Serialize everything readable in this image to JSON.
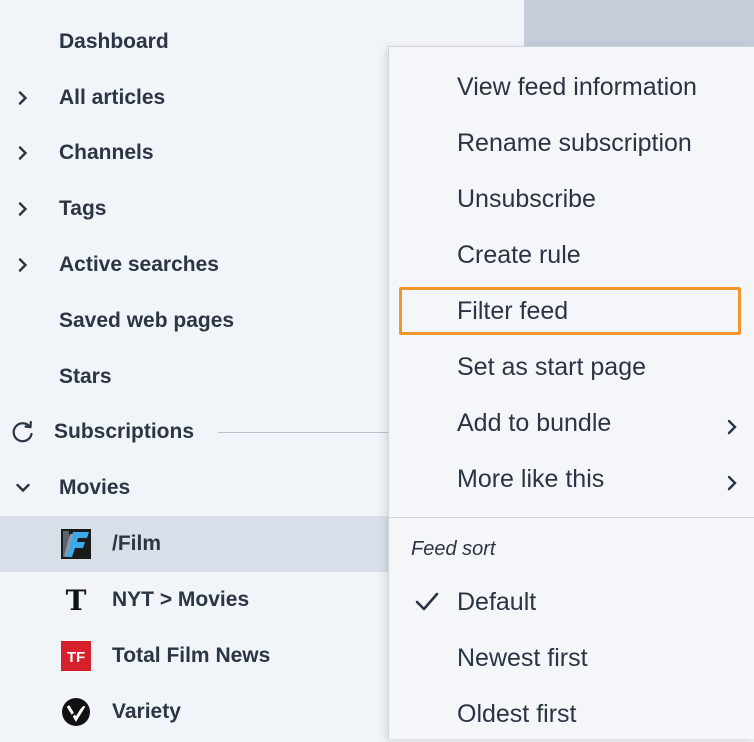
{
  "sidebar": {
    "items": [
      {
        "label": "Dashboard",
        "chevron": "none"
      },
      {
        "label": "All articles",
        "chevron": "chevron-right"
      },
      {
        "label": "Channels",
        "chevron": "chevron-right"
      },
      {
        "label": "Tags",
        "chevron": "chevron-right"
      },
      {
        "label": "Active searches",
        "chevron": "chevron-right"
      },
      {
        "label": "Saved web pages",
        "chevron": "none"
      },
      {
        "label": "Stars",
        "chevron": "none"
      }
    ],
    "subscriptions": {
      "label": "Subscriptions",
      "icon": "refresh-icon"
    },
    "folder": {
      "label": "Movies",
      "chevron": "chevron-down"
    },
    "feeds": [
      {
        "label": "/Film",
        "icon": "slashfilm-icon",
        "selected": true
      },
      {
        "label": "NYT > Movies",
        "icon": "nyt-icon",
        "selected": false
      },
      {
        "label": "Total Film News",
        "icon": "totalfilm-icon",
        "icon_text": "TF",
        "selected": false
      },
      {
        "label": "Variety",
        "icon": "variety-icon",
        "selected": false
      }
    ]
  },
  "context_menu": {
    "items": [
      {
        "label": "View feed information"
      },
      {
        "label": "Rename subscription"
      },
      {
        "label": "Unsubscribe"
      },
      {
        "label": "Create rule"
      },
      {
        "label": "Filter feed",
        "highlighted": true
      },
      {
        "label": "Set as start page"
      },
      {
        "label": "Add to bundle",
        "submenu": true
      },
      {
        "label": "More like this",
        "submenu": true
      }
    ],
    "sort_section": {
      "title": "Feed sort",
      "options": [
        {
          "label": "Default",
          "checked": true
        },
        {
          "label": "Newest first",
          "checked": false
        },
        {
          "label": "Oldest first",
          "checked": false
        }
      ]
    }
  },
  "colors": {
    "background": "#f1f4f9",
    "selected_row": "#d9dfe8",
    "focus_outline": "#f0962a",
    "text": "#2a3442",
    "totalfilm_red": "#d6202b"
  }
}
